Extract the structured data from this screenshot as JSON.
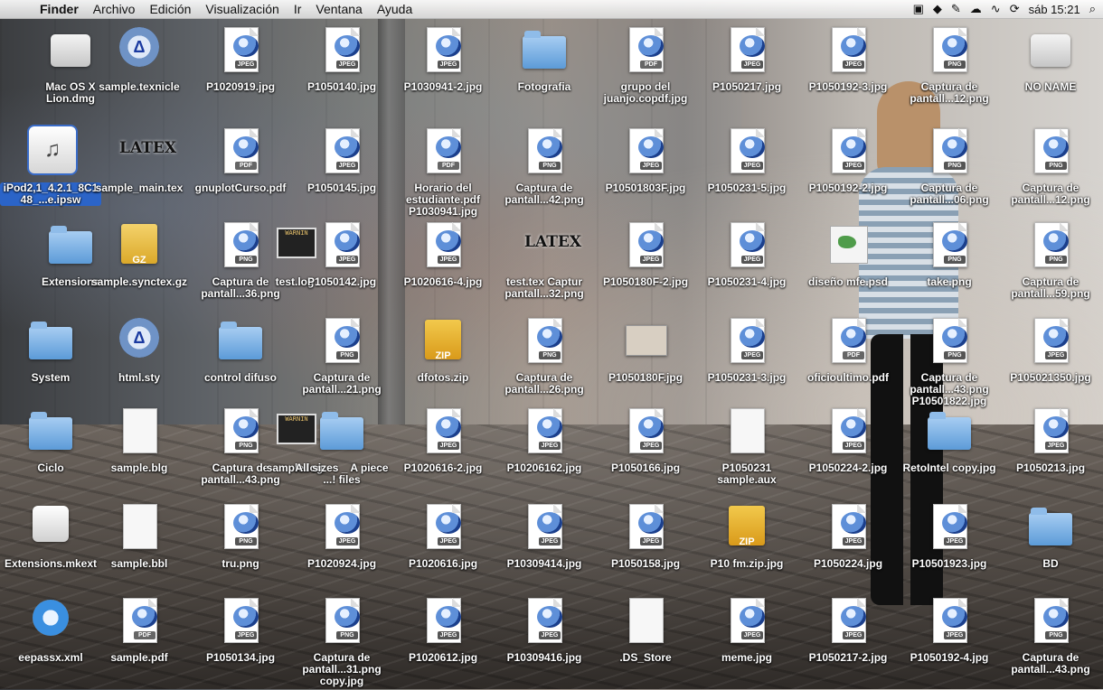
{
  "menubar": {
    "apple": "",
    "items": [
      "Finder",
      "Archivo",
      "Edición",
      "Visualización",
      "Ir",
      "Ventana",
      "Ayuda"
    ],
    "clock": "sáb 15:21",
    "status_icons": [
      "keyboard-icon",
      "dropbox-icon",
      "script-icon",
      "cloud-icon",
      "network-icon",
      "sync-icon",
      "search-icon"
    ]
  },
  "desktop": {
    "icons": [
      {
        "label": "Mac OS X Lion.dmg",
        "type": "drive"
      },
      {
        "label": "sample.texnicle",
        "type": "texapp"
      },
      {
        "label": "P1020919.jpg",
        "type": "jpeg"
      },
      {
        "label": "P1050140.jpg",
        "type": "jpeg"
      },
      {
        "label": "P1030941-2.jpg",
        "type": "jpeg"
      },
      {
        "label": "Fotografia",
        "type": "folder"
      },
      {
        "label": "grupo del juanjo.copdf.jpg",
        "type": "pdf"
      },
      {
        "label": "P1050217.jpg",
        "type": "jpeg"
      },
      {
        "label": "P1050192-3.jpg",
        "type": "jpeg"
      },
      {
        "label": "Captura de pantall...12.png",
        "type": "png"
      },
      {
        "label": "NO NAME",
        "type": "drive"
      },
      {
        "label": "iPod2,1_4.2.1_8C148_...e.ipsw",
        "type": "ipsw",
        "selected": true
      },
      {
        "label": "sample_main.tex",
        "type": "latex"
      },
      {
        "label": "gnuplotCurso.pdf",
        "type": "pdf"
      },
      {
        "label": "P1050145.jpg",
        "type": "jpeg"
      },
      {
        "label": "Horario del estudiante.pdf P1030941.jpg",
        "type": "pdf"
      },
      {
        "label": "Captura de pantall...42.png",
        "type": "png"
      },
      {
        "label": "P10501803F.jpg",
        "type": "jpeg"
      },
      {
        "label": "P1050231-5.jpg",
        "type": "jpeg"
      },
      {
        "label": "P1050192-2.jpg",
        "type": "jpeg"
      },
      {
        "label": "Captura de pantall...06.png",
        "type": "png"
      },
      {
        "label": "Captura de pantall...12.png",
        "type": "png"
      },
      {
        "label": "Extensions",
        "type": "folder"
      },
      {
        "label": "sample.synctex.gz",
        "type": "gz"
      },
      {
        "label": "Captura de pantall...36.png",
        "type": "png"
      },
      {
        "label": "test.log",
        "type": "log"
      },
      {
        "label": "P1050142.jpg",
        "type": "jpeg"
      },
      {
        "label": "P1020616-4.jpg",
        "type": "jpeg"
      },
      {
        "label": "test.tex Captur pantall...32.png",
        "type": "latex"
      },
      {
        "label": "P1050180F-2.jpg",
        "type": "jpeg"
      },
      {
        "label": "P1050231-4.jpg",
        "type": "jpeg"
      },
      {
        "label": "diseño mfe.psd",
        "type": "map"
      },
      {
        "label": "take.png",
        "type": "png"
      },
      {
        "label": "Captura de pantall...59.png",
        "type": "png"
      },
      {
        "label": "System",
        "type": "folder"
      },
      {
        "label": "html.sty",
        "type": "texapp"
      },
      {
        "label": "control difuso",
        "type": "folder"
      },
      {
        "label": "Captura de pantall...21.png",
        "type": "png"
      },
      {
        "label": "dfotos.zip",
        "type": "zip"
      },
      {
        "label": "Captura de pantall...26.png",
        "type": "png"
      },
      {
        "label": "P1050180F.jpg",
        "type": "photo"
      },
      {
        "label": "P1050231-3.jpg",
        "type": "jpeg"
      },
      {
        "label": "oficioultimo.pdf",
        "type": "pdf"
      },
      {
        "label": "Captura de pantall...43.png P10501822.jpg",
        "type": "png"
      },
      {
        "label": "P105021350.jpg",
        "type": "jpeg"
      },
      {
        "label": "Ciclo",
        "type": "folder"
      },
      {
        "label": "sample.blg",
        "type": "blank"
      },
      {
        "label": "Captura de pantall...43.png",
        "type": "png"
      },
      {
        "label": "sample.log",
        "type": "log"
      },
      {
        "label": "All sizes _ A piece ...! files",
        "type": "folder"
      },
      {
        "label": "P1020616-2.jpg",
        "type": "jpeg"
      },
      {
        "label": "P10206162.jpg",
        "type": "jpeg"
      },
      {
        "label": "P1050166.jpg",
        "type": "jpeg"
      },
      {
        "label": "P1050231 sample.aux",
        "type": "blank"
      },
      {
        "label": "P1050224-2.jpg",
        "type": "jpeg"
      },
      {
        "label": "RetoIntel copy.jpg",
        "type": "folder"
      },
      {
        "label": "P1050213.jpg",
        "type": "jpeg"
      },
      {
        "label": "Extensions.mkext",
        "type": "lego"
      },
      {
        "label": "sample.bbl",
        "type": "blank"
      },
      {
        "label": "tru.png",
        "type": "png"
      },
      {
        "label": "P1020924.jpg",
        "type": "jpeg"
      },
      {
        "label": "P1020616.jpg",
        "type": "jpeg"
      },
      {
        "label": "P10309414.jpg",
        "type": "jpeg"
      },
      {
        "label": "P1050158.jpg",
        "type": "jpeg"
      },
      {
        "label": "P10 fm.zip.jpg",
        "type": "zip"
      },
      {
        "label": "P1050224.jpg",
        "type": "jpeg"
      },
      {
        "label": "P10501923.jpg",
        "type": "jpeg"
      },
      {
        "label": "BD",
        "type": "folder"
      },
      {
        "label": "eepassx.xml",
        "type": "safari"
      },
      {
        "label": "sample.pdf",
        "type": "pdf"
      },
      {
        "label": "P1050134.jpg",
        "type": "jpeg"
      },
      {
        "label": "Captura de pantall...31.png copy.jpg",
        "type": "png"
      },
      {
        "label": "P1020612.jpg",
        "type": "jpeg"
      },
      {
        "label": "P10309416.jpg",
        "type": "jpeg"
      },
      {
        "label": ".DS_Store",
        "type": "blank"
      },
      {
        "label": "meme.jpg",
        "type": "jpeg"
      },
      {
        "label": "P1050217-2.jpg",
        "type": "jpeg"
      },
      {
        "label": "P1050192-4.jpg",
        "type": "jpeg"
      },
      {
        "label": "Captura de pantall...43.png",
        "type": "png"
      }
    ]
  }
}
